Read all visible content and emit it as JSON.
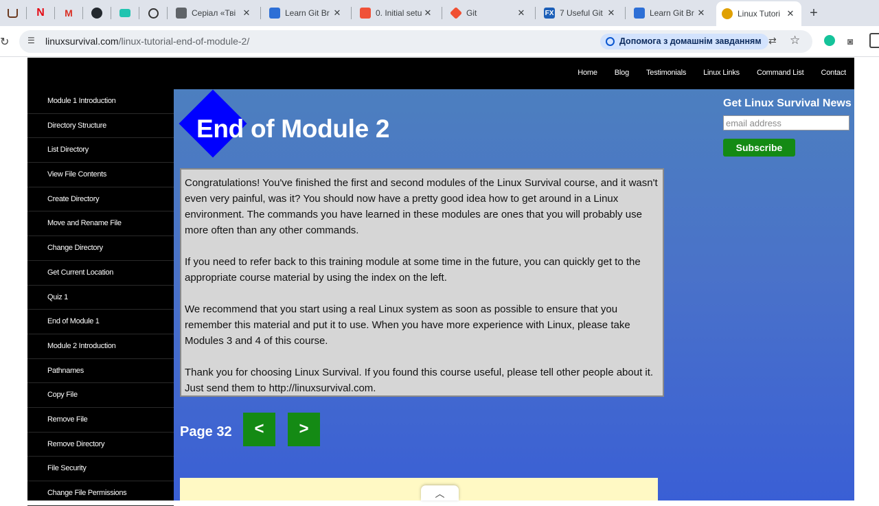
{
  "browser": {
    "pinned_tabs": [
      "ulauncher",
      "netflix",
      "gmail",
      "github",
      "cursor",
      "chatgpt"
    ],
    "tabs": [
      {
        "title": "Серіал «Тві",
        "icon": "film-icon",
        "color": "#5f6368"
      },
      {
        "title": "Learn Git Br",
        "icon": "branch-icon",
        "color": "#2d6fd6"
      },
      {
        "title": "0. Initial setu",
        "icon": "swift-icon",
        "color": "#f05138"
      },
      {
        "title": "Git",
        "icon": "git-icon",
        "color": "#f05033"
      },
      {
        "title": "7 Useful Git",
        "icon": "fx-icon",
        "color": "#1c5fb8"
      },
      {
        "title": "Learn Git Br",
        "icon": "branch-icon",
        "color": "#2d6fd6"
      },
      {
        "title": "Linux Tutori",
        "icon": "linux-survival-icon",
        "color": "#e0a000"
      }
    ],
    "url_host": "linuxsurvival.com",
    "url_path": "/linux-tutorial-end-of-module-2/",
    "homework_chip": "Допомога з домашнім завданням"
  },
  "topnav": [
    "Home",
    "Blog",
    "Testimonials",
    "Linux Links",
    "Command List",
    "Contact"
  ],
  "sidebar": [
    "Module 1 Introduction",
    "Directory Structure",
    "List Directory",
    "View File Contents",
    "Create Directory",
    "Move and Rename File",
    "Change Directory",
    "Get Current Location",
    "Quiz 1",
    "End of Module 1",
    "Module 2 Introduction",
    "Pathnames",
    "Copy File",
    "Remove File",
    "Remove Directory",
    "File Security",
    "Change File Permissions"
  ],
  "main": {
    "title": "End of Module 2",
    "paragraphs": [
      "Congratulations! You've finished the first and second modules of the Linux Survival course, and it wasn't even very painful, was it? You should now have a pretty good idea how to get around in a Linux environment. The commands you have learned in these modules are ones that you will probably use more often than any other commands.",
      "If you need to refer back to this training module at some time in the future, you can quickly get to the appropriate course material by using the index on the left.",
      "We recommend that you start using a real Linux system as soon as possible to ensure that you remember this material and put it to use. When you have more experience with Linux, please take Modules 3 and 4 of this course.",
      "Thank you for choosing Linux Survival. If you found this course useful, please tell other people about it. Just send them to http://linuxsurvival.com."
    ],
    "page_label": "Page 32",
    "prev_label": "<",
    "next_label": ">"
  },
  "newsletter": {
    "title": "Get Linux Survival News",
    "email_placeholder": "email address",
    "subscribe_label": "Subscribe"
  },
  "colors": {
    "accent_green": "#148a14",
    "diamond_blue": "#0000ff"
  }
}
